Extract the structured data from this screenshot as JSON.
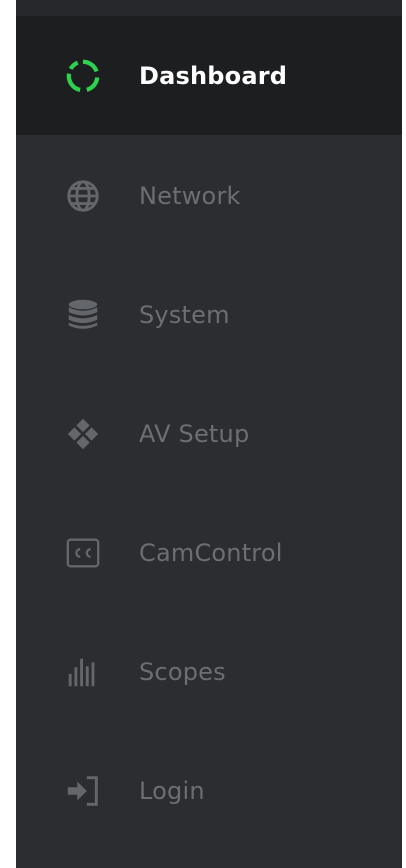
{
  "nav": {
    "items": [
      {
        "label": "Dashboard",
        "icon": "dashboard-ring-icon",
        "active": true
      },
      {
        "label": "Network",
        "icon": "globe-icon",
        "active": false
      },
      {
        "label": "System",
        "icon": "database-icon",
        "active": false
      },
      {
        "label": "AV Setup",
        "icon": "diamond-cluster-icon",
        "active": false
      },
      {
        "label": "CamControl",
        "icon": "cc-box-icon",
        "active": false
      },
      {
        "label": "Scopes",
        "icon": "bars-icon",
        "active": false
      },
      {
        "label": "Login",
        "icon": "login-arrow-icon",
        "active": false
      }
    ]
  },
  "colors": {
    "sidebar_bg": "#2b2d30",
    "active_bg": "#1d1e20",
    "active_text": "#ffffff",
    "inactive_text": "#6b6e73",
    "accent_green": "#2fd24f",
    "icon_gray": "#63666b"
  }
}
